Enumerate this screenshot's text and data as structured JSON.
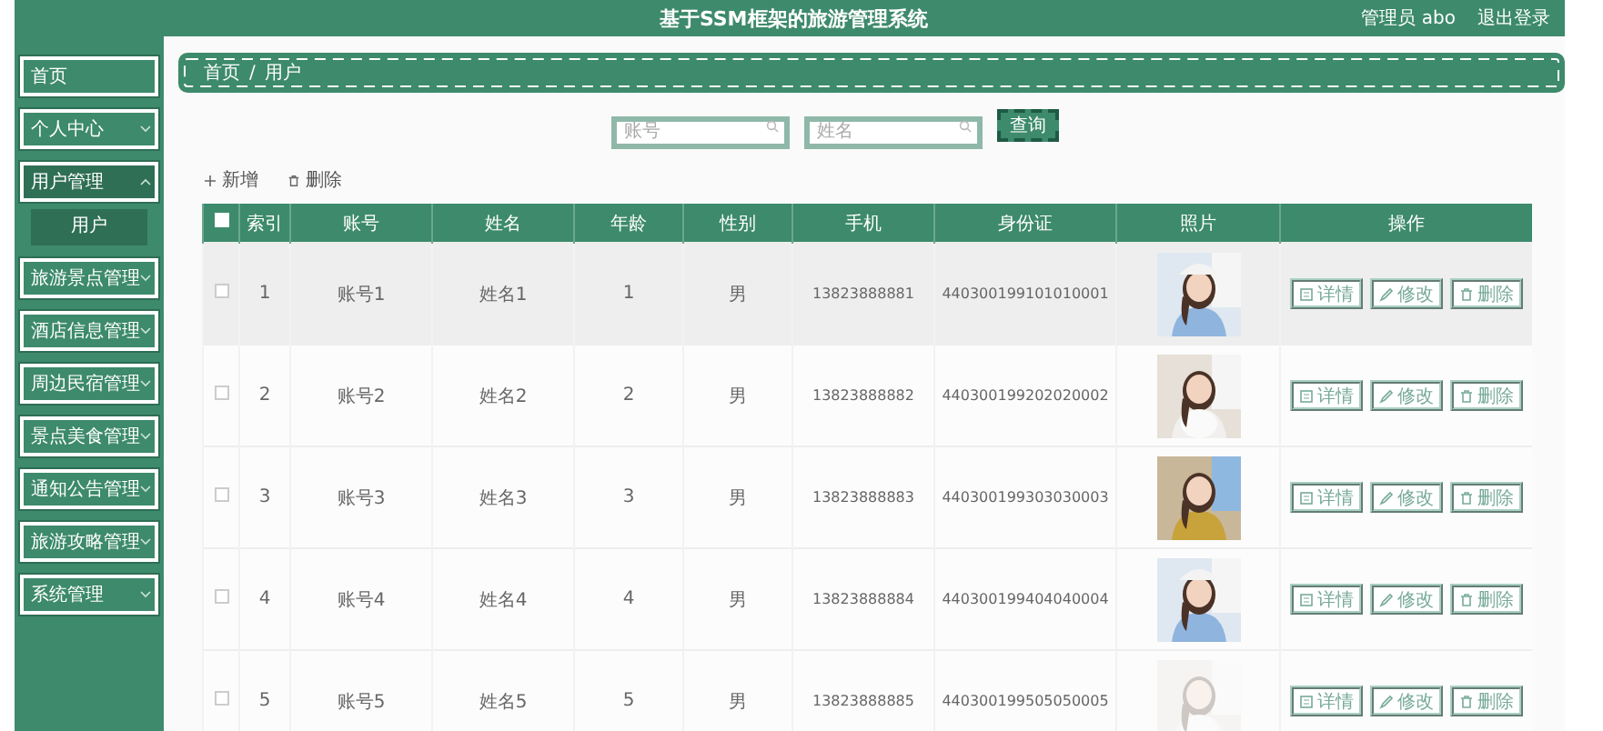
{
  "header": {
    "title": "基于SSM框架的旅游管理系统",
    "user": "管理员 abo",
    "logout": "退出登录"
  },
  "sidebar": {
    "items": [
      {
        "label": "首页",
        "has_children": false
      },
      {
        "label": "个人中心",
        "has_children": true,
        "expanded": false
      },
      {
        "label": "用户管理",
        "has_children": true,
        "expanded": true,
        "children": [
          {
            "label": "用户",
            "selected": true
          }
        ]
      },
      {
        "label": "旅游景点管理",
        "has_children": true,
        "expanded": false
      },
      {
        "label": "酒店信息管理",
        "has_children": true,
        "expanded": false
      },
      {
        "label": "周边民宿管理",
        "has_children": true,
        "expanded": false
      },
      {
        "label": "景点美食管理",
        "has_children": true,
        "expanded": false
      },
      {
        "label": "通知公告管理",
        "has_children": true,
        "expanded": false
      },
      {
        "label": "旅游攻略管理",
        "has_children": true,
        "expanded": false
      },
      {
        "label": "系统管理",
        "has_children": true,
        "expanded": false
      }
    ]
  },
  "breadcrumb": {
    "items": [
      "首页",
      "用户"
    ],
    "separator": "/"
  },
  "search": {
    "fields": [
      {
        "placeholder": "账号"
      },
      {
        "placeholder": "姓名"
      }
    ],
    "button": "查询"
  },
  "toolbar": {
    "add": "新增",
    "delete": "删除"
  },
  "table": {
    "header_checked": false,
    "columns": [
      "索引",
      "账号",
      "姓名",
      "年龄",
      "性别",
      "手机",
      "身份证",
      "照片",
      "操作"
    ],
    "rows": [
      {
        "checked": false,
        "highlighted": true,
        "cells": [
          "1",
          "账号1",
          "姓名1",
          "1",
          "男",
          "13823888881",
          "440300199101010001"
        ],
        "actions": [
          "详情",
          "修改",
          "删除"
        ]
      },
      {
        "checked": false,
        "highlighted": false,
        "cells": [
          "2",
          "账号2",
          "姓名2",
          "2",
          "男",
          "13823888882",
          "440300199202020002"
        ],
        "actions": [
          "详情",
          "修改",
          "删除"
        ]
      },
      {
        "checked": false,
        "highlighted": false,
        "cells": [
          "3",
          "账号3",
          "姓名3",
          "3",
          "男",
          "13823888883",
          "440300199303030003"
        ],
        "actions": [
          "详情",
          "修改",
          "删除"
        ]
      },
      {
        "checked": false,
        "highlighted": false,
        "cells": [
          "4",
          "账号4",
          "姓名4",
          "4",
          "男",
          "13823888884",
          "440300199404040004"
        ],
        "actions": [
          "详情",
          "修改",
          "删除"
        ]
      },
      {
        "checked": false,
        "highlighted": false,
        "cells": [
          "5",
          "账号5",
          "姓名5",
          "5",
          "男",
          "13823888885",
          "440300199505050005"
        ],
        "actions": [
          "详情",
          "修改",
          "删除"
        ]
      }
    ]
  }
}
